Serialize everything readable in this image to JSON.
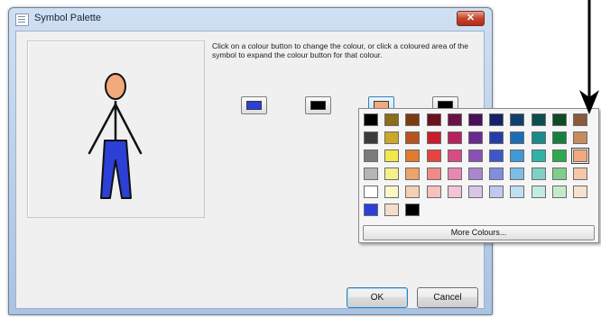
{
  "window": {
    "title": "Symbol Palette",
    "close_glyph": "✕"
  },
  "instructions": "Click on a colour button to change the colour, or click a coloured area of the symbol to expand the colour button for that colour.",
  "symbol": {
    "head_color": "#f2a97c",
    "body_color": "#111111",
    "legs_color": "#2c3fd6"
  },
  "colour_buttons": [
    {
      "name": "blue",
      "color": "#2c3fd6"
    },
    {
      "name": "black-1",
      "color": "#000000"
    },
    {
      "name": "peach",
      "color": "#f2a97c"
    },
    {
      "name": "black-2",
      "color": "#000000"
    }
  ],
  "palette": {
    "rows": [
      [
        "#000000",
        "#8b6d1a",
        "#7a3b12",
        "#6e0f1c",
        "#6b1247",
        "#4a0f59",
        "#17206a",
        "#103f6e",
        "#0c4e4e",
        "#0d4a25",
        "#8a5a3c"
      ],
      [
        "#3b3b3b",
        "#c9a82a",
        "#b8531d",
        "#c71e2e",
        "#b8205e",
        "#6b2a8e",
        "#263ca8",
        "#1c6db3",
        "#1a8a8a",
        "#15803d",
        "#c98b5c"
      ],
      [
        "#7a7a7a",
        "#f2e84a",
        "#e07a2e",
        "#e6453f",
        "#d94a86",
        "#8a50b4",
        "#3e57c8",
        "#3e9ad6",
        "#2eb3a6",
        "#2ea84f",
        "#f2a97c"
      ],
      [
        "#b5b5b5",
        "#f5f08a",
        "#eda36a",
        "#ef8a86",
        "#e788b2",
        "#ab86cf",
        "#7f8fdc",
        "#7fbde6",
        "#7fd1c6",
        "#7fcf8c",
        "#f3c7a8"
      ],
      [
        "#ffffff",
        "#faf8c4",
        "#f5cfb1",
        "#f5c2c0",
        "#f2c4d8",
        "#d7c6e8",
        "#c1c8ee",
        "#c0def3",
        "#c2ebe4",
        "#c3ebc9",
        "#f8e0cf"
      ],
      [
        "#2c3fd6",
        "#f6dccb",
        "#000000"
      ]
    ],
    "selected": {
      "row": 2,
      "col": 10
    },
    "more_label": "More Colours..."
  },
  "buttons": {
    "ok": "OK",
    "cancel": "Cancel"
  }
}
